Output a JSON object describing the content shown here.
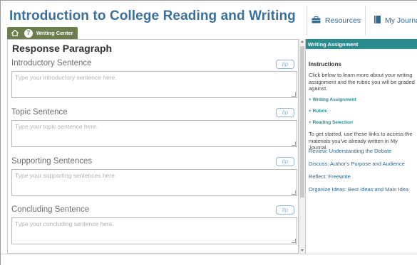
{
  "header": {
    "app_title": "Introduction to College Reading and Writing",
    "resources_label": "Resources",
    "journal_label": "My Journal"
  },
  "breadcrumb": {
    "step_number": "7",
    "label": "Writing Center"
  },
  "editor": {
    "title": "Response Paragraph",
    "tip_label": "tip",
    "sections": [
      {
        "label": "Introductory Sentence",
        "placeholder": "Type your introductory sentence here."
      },
      {
        "label": "Topic Sentence",
        "placeholder": "Type your topic sentence here."
      },
      {
        "label": "Supporting Sentences",
        "placeholder": "Type your supporting sentences here."
      },
      {
        "label": "Concluding Sentence",
        "placeholder": "Type your concluding sentence here."
      }
    ]
  },
  "sidebar": {
    "header": "Writing Assignment",
    "instructions_heading": "Instructions",
    "instructions_text": "Click below to learn more about your writing assignment and the rubric you will be graded against.",
    "toggles": [
      "+ Writing Assignment",
      "+ Rubric",
      "+ Reading Selection"
    ],
    "links_intro": "To get started, use these links to access the materials you've already written in My Journal.",
    "links": [
      "Review: Understanding the Debate",
      "Discuss: Author's Purpose and Audience",
      "Reflect: Freewrite",
      "Organize Ideas: Best Ideas and Main Idea"
    ]
  },
  "colors": {
    "title_blue": "#3a6f9c",
    "breadcrumb_olive": "#6b7f4e",
    "sidebar_teal": "#2a8c8f",
    "tip_blue": "#8fb9cf"
  },
  "icons": {
    "resources": "briefcase-icon",
    "journal": "journal-book-icon",
    "home": "home-icon"
  }
}
